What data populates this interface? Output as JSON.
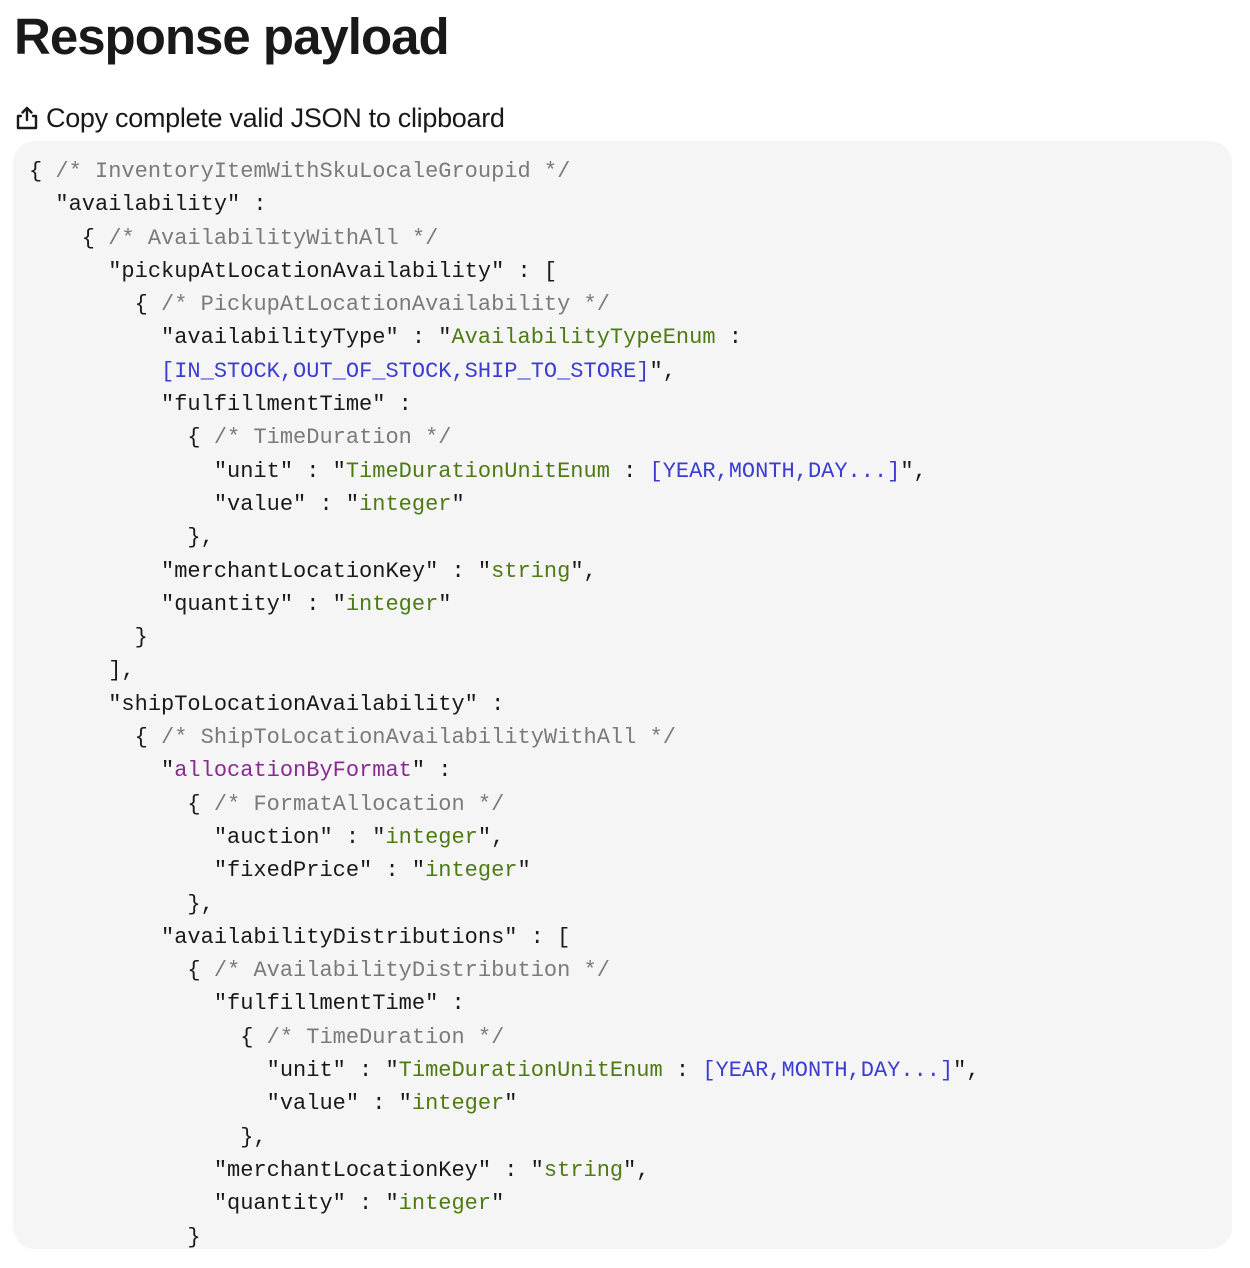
{
  "page": {
    "title": "Response payload",
    "copy_label": "Copy complete valid JSON to clipboard",
    "copy_icon": "share-upload-icon"
  },
  "code_lines": [
    [
      {
        "t": "p",
        "v": "{ "
      },
      {
        "t": "c",
        "v": "/* InventoryItemWithSkuLocaleGroupid */"
      }
    ],
    [
      {
        "t": "k",
        "v": "  \"availability\""
      },
      {
        "t": "p",
        "v": " :"
      }
    ],
    [
      {
        "t": "p",
        "v": "    { "
      },
      {
        "t": "c",
        "v": "/* AvailabilityWithAll */"
      }
    ],
    [
      {
        "t": "k",
        "v": "      \"pickupAtLocationAvailability\""
      },
      {
        "t": "p",
        "v": " : ["
      }
    ],
    [
      {
        "t": "p",
        "v": "        { "
      },
      {
        "t": "c",
        "v": "/* PickupAtLocationAvailability */"
      }
    ],
    [
      {
        "t": "k",
        "v": "          \"availabilityType\""
      },
      {
        "t": "p",
        "v": " : \""
      },
      {
        "t": "s",
        "v": "AvailabilityTypeEnum"
      },
      {
        "t": "p",
        "v": " :"
      }
    ],
    [
      {
        "t": "p",
        "v": "          "
      },
      {
        "t": "e",
        "v": "[IN_STOCK,OUT_OF_STOCK,SHIP_TO_STORE]"
      },
      {
        "t": "p",
        "v": "\","
      }
    ],
    [
      {
        "t": "k",
        "v": "          \"fulfillmentTime\""
      },
      {
        "t": "p",
        "v": " :"
      }
    ],
    [
      {
        "t": "p",
        "v": "            { "
      },
      {
        "t": "c",
        "v": "/* TimeDuration */"
      }
    ],
    [
      {
        "t": "k",
        "v": "              \"unit\""
      },
      {
        "t": "p",
        "v": " : \""
      },
      {
        "t": "s",
        "v": "TimeDurationUnitEnum"
      },
      {
        "t": "p",
        "v": " : "
      },
      {
        "t": "e",
        "v": "[YEAR,MONTH,DAY...]"
      },
      {
        "t": "p",
        "v": "\","
      }
    ],
    [
      {
        "t": "k",
        "v": "              \"value\""
      },
      {
        "t": "p",
        "v": " : \""
      },
      {
        "t": "s",
        "v": "integer"
      },
      {
        "t": "p",
        "v": "\""
      }
    ],
    [
      {
        "t": "p",
        "v": "            },"
      }
    ],
    [
      {
        "t": "k",
        "v": "          \"merchantLocationKey\""
      },
      {
        "t": "p",
        "v": " : \""
      },
      {
        "t": "s",
        "v": "string"
      },
      {
        "t": "p",
        "v": "\","
      }
    ],
    [
      {
        "t": "k",
        "v": "          \"quantity\""
      },
      {
        "t": "p",
        "v": " : \""
      },
      {
        "t": "s",
        "v": "integer"
      },
      {
        "t": "p",
        "v": "\""
      }
    ],
    [
      {
        "t": "p",
        "v": "        }"
      }
    ],
    [
      {
        "t": "p",
        "v": "      ],"
      }
    ],
    [
      {
        "t": "k",
        "v": "      \"shipToLocationAvailability\""
      },
      {
        "t": "p",
        "v": " :"
      }
    ],
    [
      {
        "t": "p",
        "v": "        { "
      },
      {
        "t": "c",
        "v": "/* ShipToLocationAvailabilityWithAll */"
      }
    ],
    [
      {
        "t": "k",
        "v": "          \""
      },
      {
        "t": "a",
        "v": "allocationByFormat"
      },
      {
        "t": "k",
        "v": "\""
      },
      {
        "t": "p",
        "v": " :"
      }
    ],
    [
      {
        "t": "p",
        "v": "            { "
      },
      {
        "t": "c",
        "v": "/* FormatAllocation */"
      }
    ],
    [
      {
        "t": "k",
        "v": "              \"auction\""
      },
      {
        "t": "p",
        "v": " : \""
      },
      {
        "t": "s",
        "v": "integer"
      },
      {
        "t": "p",
        "v": "\","
      }
    ],
    [
      {
        "t": "k",
        "v": "              \"fixedPrice\""
      },
      {
        "t": "p",
        "v": " : \""
      },
      {
        "t": "s",
        "v": "integer"
      },
      {
        "t": "p",
        "v": "\""
      }
    ],
    [
      {
        "t": "p",
        "v": "            },"
      }
    ],
    [
      {
        "t": "k",
        "v": "          \"availabilityDistributions\""
      },
      {
        "t": "p",
        "v": " : ["
      }
    ],
    [
      {
        "t": "p",
        "v": "            { "
      },
      {
        "t": "c",
        "v": "/* AvailabilityDistribution */"
      }
    ],
    [
      {
        "t": "k",
        "v": "              \"fulfillmentTime\""
      },
      {
        "t": "p",
        "v": " :"
      }
    ],
    [
      {
        "t": "p",
        "v": "                { "
      },
      {
        "t": "c",
        "v": "/* TimeDuration */"
      }
    ],
    [
      {
        "t": "k",
        "v": "                  \"unit\""
      },
      {
        "t": "p",
        "v": " : \""
      },
      {
        "t": "s",
        "v": "TimeDurationUnitEnum"
      },
      {
        "t": "p",
        "v": " : "
      },
      {
        "t": "e",
        "v": "[YEAR,MONTH,DAY...]"
      },
      {
        "t": "p",
        "v": "\","
      }
    ],
    [
      {
        "t": "k",
        "v": "                  \"value\""
      },
      {
        "t": "p",
        "v": " : \""
      },
      {
        "t": "s",
        "v": "integer"
      },
      {
        "t": "p",
        "v": "\""
      }
    ],
    [
      {
        "t": "p",
        "v": "                },"
      }
    ],
    [
      {
        "t": "k",
        "v": "              \"merchantLocationKey\""
      },
      {
        "t": "p",
        "v": " : \""
      },
      {
        "t": "s",
        "v": "string"
      },
      {
        "t": "p",
        "v": "\","
      }
    ],
    [
      {
        "t": "k",
        "v": "              \"quantity\""
      },
      {
        "t": "p",
        "v": " : \""
      },
      {
        "t": "s",
        "v": "integer"
      },
      {
        "t": "p",
        "v": "\""
      }
    ],
    [
      {
        "t": "p",
        "v": "            }"
      }
    ]
  ]
}
